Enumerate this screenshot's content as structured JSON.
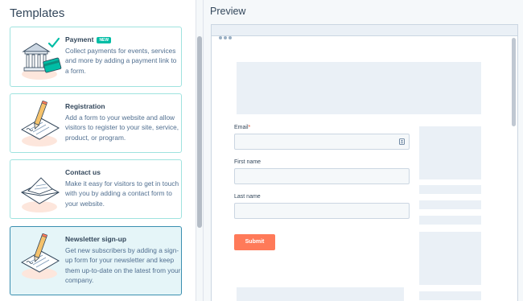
{
  "templates": {
    "heading": "Templates",
    "cards": [
      {
        "title": "Payment",
        "badge": "NEW",
        "description": "Collect payments for events, services and more by adding a payment link to a form."
      },
      {
        "title": "Registration",
        "description": "Add a form to your website and allow visitors to register to your site, service, product, or program."
      },
      {
        "title": "Contact us",
        "description": "Make it easy for visitors to get in touch with you by adding a contact form to your website."
      },
      {
        "title": "Newsletter sign-up",
        "description": "Get new subscribers by adding a sign-up form for your newsletter and keep them up-to-date on the latest from your company."
      }
    ]
  },
  "preview": {
    "heading": "Preview",
    "fields": [
      {
        "label": "Email",
        "required_mark": "*"
      },
      {
        "label": "First name"
      },
      {
        "label": "Last name"
      }
    ],
    "submit_label": "Submit"
  },
  "colors": {
    "accent_teal": "#00bda5",
    "submit": "#ff7a59",
    "selected_card": "#e5f5f8"
  },
  "icons": [
    "bank-card-icon",
    "clipboard-pencil-icon",
    "envelope-icon",
    "newsletter-pencil-icon",
    "contact-card-icon",
    "window-dots-icon"
  ]
}
